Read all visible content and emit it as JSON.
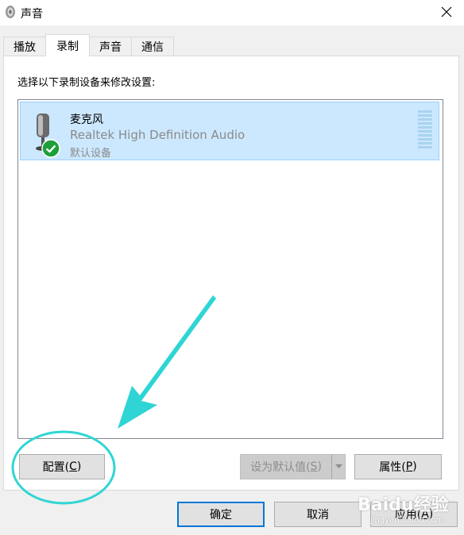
{
  "window": {
    "title": "声音"
  },
  "tabs": [
    {
      "label": "播放",
      "active": false
    },
    {
      "label": "录制",
      "active": true
    },
    {
      "label": "声音",
      "active": false
    },
    {
      "label": "通信",
      "active": false
    }
  ],
  "instruction": "选择以下录制设备来修改设置:",
  "devices": [
    {
      "name": "麦克风",
      "driver": "Realtek High Definition Audio",
      "status": "默认设备",
      "selected": true,
      "icon": "microphone-icon",
      "badge": "check-icon"
    }
  ],
  "buttons": {
    "configure": {
      "prefix": "配置(",
      "key": "C",
      "suffix": ")"
    },
    "set_default": {
      "prefix": "设为默认值(",
      "key": "S",
      "suffix": ")",
      "enabled": false
    },
    "properties": {
      "prefix": "属性(",
      "key": "P",
      "suffix": ")"
    },
    "ok": "确定",
    "cancel": "取消",
    "apply": {
      "prefix": "应用(",
      "key": "A",
      "suffix": ")"
    }
  },
  "colors": {
    "selection": "#cce8ff",
    "annotation": "#2fd5d5",
    "check": "#1e9e3a"
  },
  "watermark": {
    "brand": "Baidu经验",
    "url": "jingyan.baidu.com"
  }
}
